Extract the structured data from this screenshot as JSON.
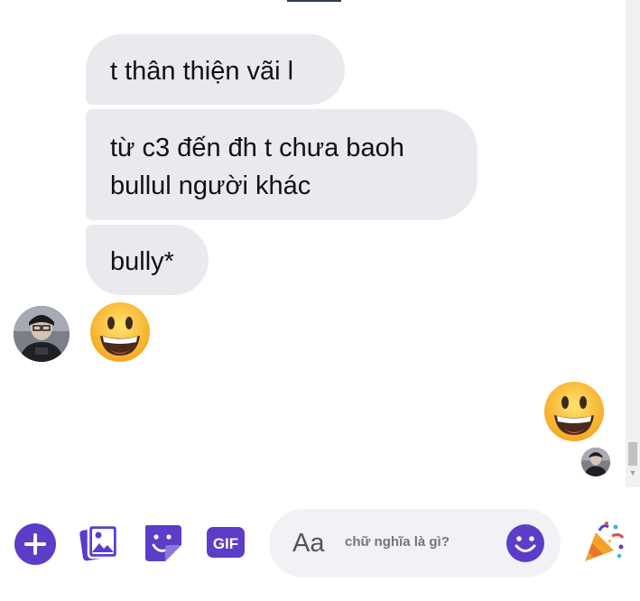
{
  "messages": [
    {
      "text": "t thân thiện vãi l"
    },
    {
      "lines": [
        "từ c3 đến đh t chưa baoh",
        "bullul người khác"
      ]
    },
    {
      "text": "bully*"
    }
  ],
  "composer": {
    "aa": "Aa",
    "placeholder": "chữ nghĩa là gì?",
    "gif": "GIF"
  },
  "colors": {
    "accent": "#5c3dc8",
    "bubble": "#e9e9ee",
    "input_bg": "#f2f1f5"
  },
  "icons": {
    "plus": "plus-icon",
    "photo": "photo-icon",
    "sticker": "sticker-icon",
    "gif": "gif-icon",
    "smile": "smile-icon",
    "party": "party-popper-icon",
    "emoji": "grinning-face-emoji"
  }
}
